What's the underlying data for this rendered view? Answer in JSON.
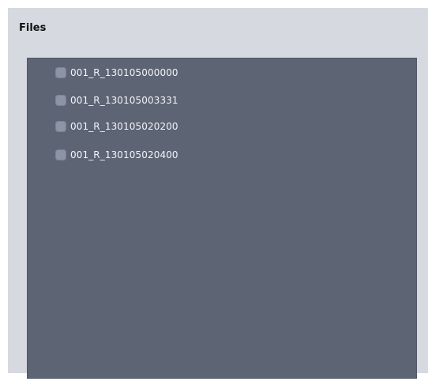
{
  "panel": {
    "title": "Files"
  },
  "files": [
    {
      "name": "001_R_130105000000",
      "checked": false
    },
    {
      "name": "001_R_130105003331",
      "checked": false
    },
    {
      "name": "001_R_130105020200",
      "checked": false
    },
    {
      "name": "001_R_130105020400",
      "checked": false
    }
  ],
  "colors": {
    "panel_background": "#d6d9e0",
    "list_background": "#5d6474",
    "item_text": "#f2f4f7",
    "checkbox": "#8c94a6"
  }
}
